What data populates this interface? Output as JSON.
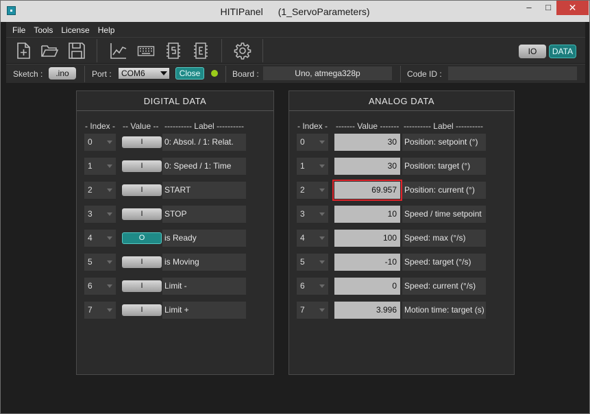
{
  "window": {
    "title": "HITIPanel",
    "subtitle": "(1_ServoParameters)"
  },
  "menu": [
    "File",
    "Tools",
    "License",
    "Help"
  ],
  "toolbar": {
    "io_label": "IO",
    "data_label": "DATA"
  },
  "status": {
    "sketch_label": "Sketch :",
    "sketch_button": ".ino",
    "port_label": "Port :",
    "port_value": "COM6",
    "close_button": "Close",
    "board_label": "Board :",
    "board_value": "Uno, atmega328p",
    "code_id_label": "Code ID :",
    "code_id_value": ""
  },
  "digital": {
    "title": "DIGITAL  DATA",
    "headers": {
      "index": "- Index -",
      "value": "-- Value --",
      "label": "---------- Label ----------"
    },
    "rows": [
      {
        "index": "0",
        "value": "I",
        "on": false,
        "label": "0: Absol. / 1: Relat."
      },
      {
        "index": "1",
        "value": "I",
        "on": false,
        "label": "0: Speed / 1: Time"
      },
      {
        "index": "2",
        "value": "I",
        "on": false,
        "label": "START"
      },
      {
        "index": "3",
        "value": "I",
        "on": false,
        "label": "STOP"
      },
      {
        "index": "4",
        "value": "O",
        "on": true,
        "label": "is Ready"
      },
      {
        "index": "5",
        "value": "I",
        "on": false,
        "label": "is Moving"
      },
      {
        "index": "6",
        "value": "I",
        "on": false,
        "label": "Limit -"
      },
      {
        "index": "7",
        "value": "I",
        "on": false,
        "label": "Limit +"
      }
    ]
  },
  "analog": {
    "title": "ANALOG  DATA",
    "headers": {
      "index": "- Index -",
      "value": "------- Value -------",
      "label": "---------- Label ----------"
    },
    "rows": [
      {
        "index": "0",
        "value": "30",
        "label": "Position: setpoint (°)"
      },
      {
        "index": "1",
        "value": "30",
        "label": "Position: target (°)"
      },
      {
        "index": "2",
        "value": "69.957",
        "label": "Position: current (°)",
        "highlight": true
      },
      {
        "index": "3",
        "value": "10",
        "label": "Speed / time setpoint"
      },
      {
        "index": "4",
        "value": "100",
        "label": "Speed: max (°/s)"
      },
      {
        "index": "5",
        "value": "-10",
        "label": "Speed: target (°/s)"
      },
      {
        "index": "6",
        "value": "0",
        "label": "Speed: current (°/s)"
      },
      {
        "index": "7",
        "value": "3.996",
        "label": "Motion time: target (s)"
      }
    ]
  },
  "colors": {
    "accent": "#1f8a87",
    "highlight": "#e0242b",
    "led": "#9bcc1a"
  }
}
